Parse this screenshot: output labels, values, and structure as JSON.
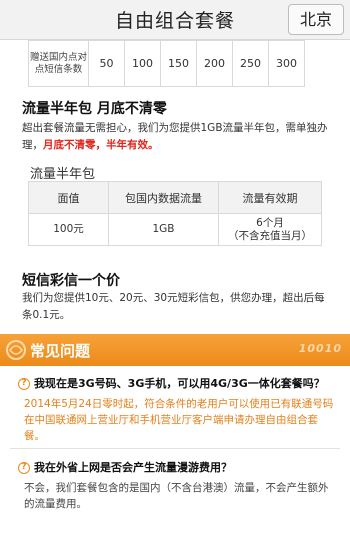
{
  "header": {
    "title": "自由组合套餐",
    "city": "北京"
  },
  "sms_row": {
    "label": "赠送国内点对点短信条数",
    "values": [
      "50",
      "100",
      "150",
      "200",
      "250",
      "300"
    ]
  },
  "flow_section": {
    "title": "流量半年包 月底不清零",
    "desc_plain": "超出套餐流量无需担心，我们为您提供1GB流量半年包，需单独办理，",
    "desc_red": "月底不清零，半年有效。",
    "subtitle": "流量半年包",
    "table": {
      "headers": [
        "面值",
        "包国内数据流量",
        "流量有效期"
      ],
      "rows": [
        [
          "100元",
          "1GB",
          "6个月\n（不含充值当月）"
        ]
      ]
    }
  },
  "mms_section": {
    "title": "短信彩信一个价",
    "desc": "我们为您提供10元、20元、30元短彩信包，供您办理，超出后每条0.1元。"
  },
  "faq": {
    "title": "常见问题",
    "logo": "10010",
    "items": [
      {
        "q": "我现在是3G号码、3G手机，可以用4G/3G一体化套餐吗？",
        "a": "2014年5月24日零时起，符合条件的老用户可以使用已有联通号码在中国联通网上营业厅和手机营业厅客户端申请办理自由组合套餐。"
      },
      {
        "q": "我在外省上网是否会产生流量漫游费用？",
        "a": "不会，我们套餐包含的是国内（不含台港澳）流量，不会产生额外的流量费用。"
      }
    ]
  }
}
